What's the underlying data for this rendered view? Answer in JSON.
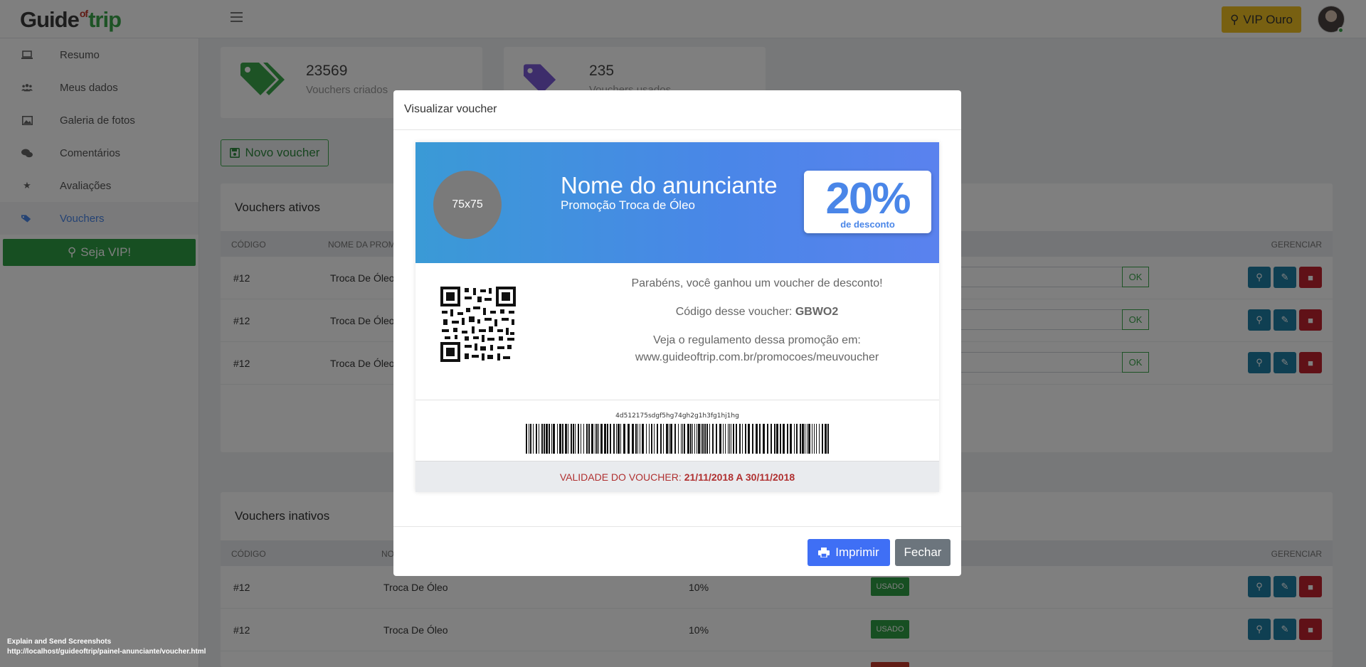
{
  "header": {
    "logo_guide": "Guide",
    "logo_of": "of",
    "logo_trip": "trip",
    "vip_label": "VIP Ouro"
  },
  "sidebar": {
    "items": [
      {
        "label": "Resumo",
        "icon": "laptop-icon"
      },
      {
        "label": "Meus dados",
        "icon": "users-icon"
      },
      {
        "label": "Galeria de fotos",
        "icon": "image-icon"
      },
      {
        "label": "Comentários",
        "icon": "comments-icon"
      },
      {
        "label": "Avaliações",
        "icon": "star-icon"
      },
      {
        "label": "Vouchers",
        "icon": "tags-icon",
        "active": true
      }
    ],
    "vip_button": "Seja VIP!"
  },
  "stats": [
    {
      "value": "23569",
      "label": "Vouchers criados",
      "color": "#3aa64a"
    },
    {
      "value": "235",
      "label": "Vouchers usados",
      "color": "#7b5bd6"
    }
  ],
  "novo_voucher": "Novo voucher",
  "ativos": {
    "title": "Vouchers ativos",
    "columns": {
      "codigo": "CÓDIGO",
      "nome": "NOME DA PROMO",
      "gerenciar": "GERENCIAR"
    },
    "rows": [
      {
        "codigo": "#12",
        "nome": "Troca De Óleo",
        "ok": "OK"
      },
      {
        "codigo": "#12",
        "nome": "Troca De Óleo",
        "ok": "OK"
      },
      {
        "codigo": "#12",
        "nome": "Troca De Óleo",
        "ok": "OK"
      }
    ]
  },
  "inativos": {
    "title": "Vouchers inativos",
    "columns": {
      "codigo": "CÓDIGO",
      "nome": "NO",
      "gerenciar": "GERENCIAR"
    },
    "rows": [
      {
        "codigo": "#12",
        "nome": "Troca De Óleo",
        "desconto": "10%",
        "status": "USADO"
      },
      {
        "codigo": "#12",
        "nome": "Troca De Óleo",
        "desconto": "10%",
        "status": "USADO"
      }
    ]
  },
  "modal": {
    "title": "Visualizar voucher",
    "voucher": {
      "logo_placeholder": "75x75",
      "advertiser": "Nome do anunciante",
      "promotion": "Promoção Troca de Óleo",
      "discount": "20%",
      "discount_label": "de desconto",
      "congrats": "Parabéns, você ganhou um voucher de desconto!",
      "code_label": "Código desse voucher:",
      "code": "GBWO2",
      "rules_label": "Veja o regulamento dessa promoção em:",
      "rules_url": "www.guideoftrip.com.br/promocoes/meuvoucher",
      "barcode_text": "4d512175sdgf5hg74gh2g1h3fg1hj1hg",
      "validity_label": "VALIDADE DO VOUCHER:",
      "validity": "21/11/2018 A 30/11/2018"
    },
    "print_label": "Imprimir",
    "close_label": "Fechar"
  },
  "footer_note": {
    "line1": "Explain and Send Screenshots",
    "line2": "http://localhost/guideoftrip/painel-anunciante/voucher.html"
  }
}
